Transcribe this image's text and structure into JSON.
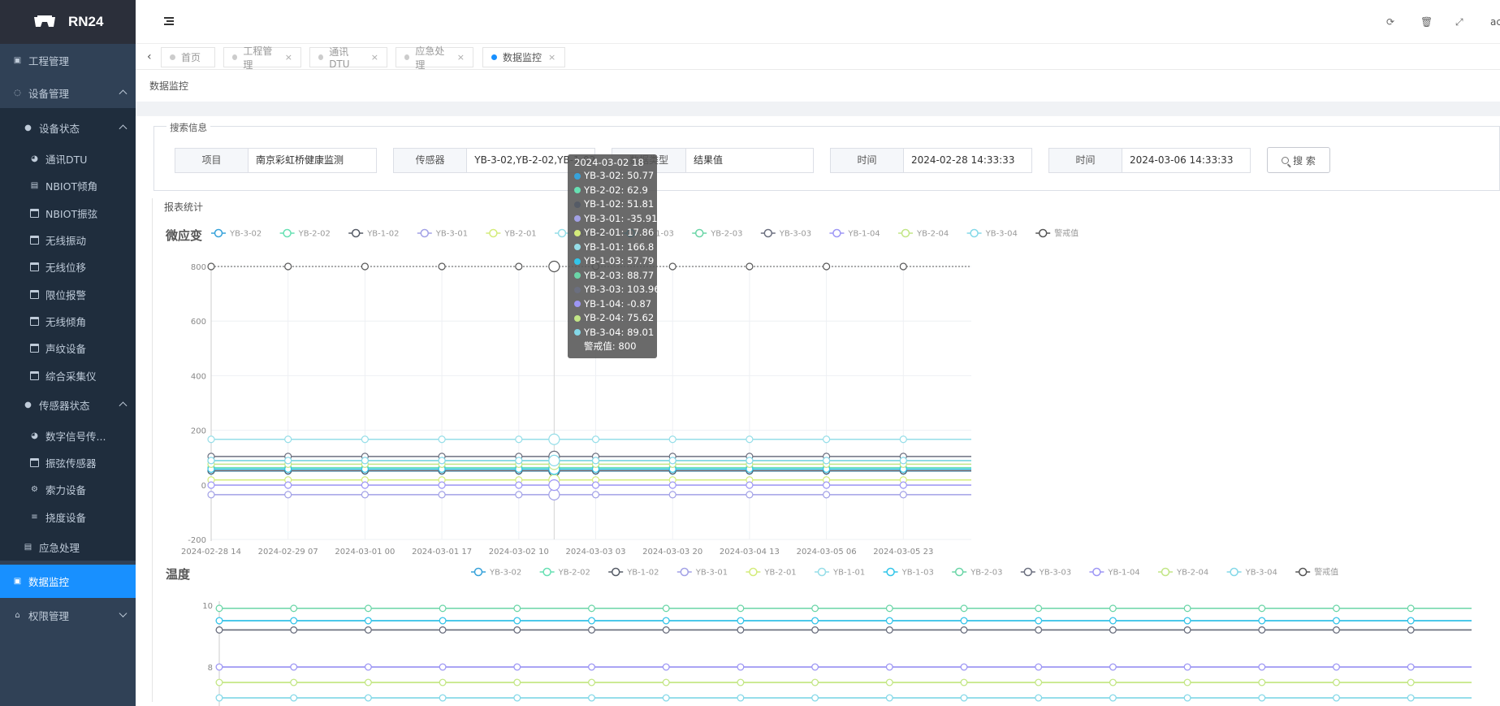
{
  "brand": {
    "name": "RN24"
  },
  "sidebar": {
    "items": [
      {
        "label": "工程管理",
        "icon": "file-icon"
      },
      {
        "label": "设备管理",
        "icon": "chat-icon"
      },
      {
        "label": "设备状态",
        "icon": "status-icon"
      },
      {
        "label": "通讯DTU",
        "icon": "dashboard-icon"
      },
      {
        "label": "NBIOT倾角",
        "icon": "document-icon"
      },
      {
        "label": "NBIOT振弦",
        "icon": "window-icon"
      },
      {
        "label": "无线振动",
        "icon": "window-icon"
      },
      {
        "label": "无线位移",
        "icon": "window-icon"
      },
      {
        "label": "限位报警",
        "icon": "window-icon"
      },
      {
        "label": "无线倾角",
        "icon": "window-icon"
      },
      {
        "label": "声纹设备",
        "icon": "window-icon"
      },
      {
        "label": "综合采集仪",
        "icon": "window-icon"
      },
      {
        "label": "传感器状态",
        "icon": "status-icon"
      },
      {
        "label": "数字信号传...",
        "icon": "dashboard-icon"
      },
      {
        "label": "振弦传感器",
        "icon": "window-icon"
      },
      {
        "label": "索力设备",
        "icon": "gears-icon"
      },
      {
        "label": "挠度设备",
        "icon": "list-icon"
      },
      {
        "label": "应急处理",
        "icon": "document-icon"
      },
      {
        "label": "数据监控",
        "icon": "monitor-icon"
      },
      {
        "label": "权限管理",
        "icon": "home-icon"
      }
    ]
  },
  "topbar": {
    "user_initial": "ac"
  },
  "tabs": [
    {
      "label": "首页"
    },
    {
      "label": "工程管理"
    },
    {
      "label": "通讯DTU"
    },
    {
      "label": "应急处理"
    },
    {
      "label": "数据监控"
    }
  ],
  "breadcrumb": "数据监控",
  "search": {
    "legend": "搜索信息",
    "project_label": "项目",
    "project_value": "南京彩虹桥健康监测",
    "sensor_label": "传感器",
    "sensor_value": "YB-3-02,YB-2-02,YB-1-02",
    "type_label": "数据类型",
    "type_value": "结果值",
    "start_label": "时间",
    "start_value": "2024-02-28 14:33:33",
    "end_label": "时间",
    "end_value": "2024-03-06 14:33:33",
    "button_label": "搜 索"
  },
  "report_title": "报表统计",
  "colors": {
    "YB-3-02": "#37a2da",
    "YB-2-02": "#67e0b3",
    "YB-1-02": "#555b66",
    "YB-3-01": "#a2a1e6",
    "YB-2-01": "#d4ec7b",
    "YB-1-01": "#96dee8",
    "YB-1-03": "#32c5e9",
    "YB-2-03": "#6bd5a7",
    "YB-3-03": "#6b6f7f",
    "YB-1-04": "#9d96f5",
    "YB-2-04": "#c2e686",
    "YB-3-04": "#84d8e8",
    "警戒值": "#555555"
  },
  "chart_data": [
    {
      "type": "line",
      "title": "微应变",
      "categories": [
        "2024-02-28 14",
        "2024-02-29 07",
        "2024-03-01 00",
        "2024-03-01 17",
        "2024-03-02 10",
        "2024-03-02 18",
        "2024-03-03 03",
        "2024-03-03 20",
        "2024-03-04 13",
        "2024-03-05 06",
        "2024-03-05 23"
      ],
      "x_tick_labels": [
        "2024-02-28 14",
        "2024-02-29 07",
        "2024-03-01 00",
        "2024-03-01 17",
        "2024-03-02 10",
        "2024-03-03 03",
        "2024-03-03 20",
        "2024-03-04 13",
        "2024-03-05 06",
        "2024-03-05 23"
      ],
      "ylim": [
        -200,
        800
      ],
      "y_ticks": [
        -200,
        0,
        200,
        400,
        600,
        800
      ],
      "legend": "top",
      "grid": true,
      "series": [
        {
          "name": "YB-3-02",
          "value": 50.77
        },
        {
          "name": "YB-2-02",
          "value": 62.9
        },
        {
          "name": "YB-1-02",
          "value": 51.81
        },
        {
          "name": "YB-3-01",
          "value": -35.91
        },
        {
          "name": "YB-2-01",
          "value": 17.86
        },
        {
          "name": "YB-1-01",
          "value": 166.8
        },
        {
          "name": "YB-1-03",
          "value": 57.79
        },
        {
          "name": "YB-2-03",
          "value": 88.77
        },
        {
          "name": "YB-3-03",
          "value": 103.96
        },
        {
          "name": "YB-1-04",
          "value": -0.87
        },
        {
          "name": "YB-2-04",
          "value": 75.62
        },
        {
          "name": "YB-3-04",
          "value": 89.01
        },
        {
          "name": "警戒值",
          "value": 800
        }
      ],
      "tooltip": {
        "title": "2024-03-02 18"
      }
    },
    {
      "type": "line",
      "title": "温度",
      "categories": 17,
      "y_ticks": [
        8,
        10
      ],
      "legend": "top",
      "grid": false,
      "series": [
        {
          "name": "YB-3-02",
          "value": 9.5
        },
        {
          "name": "YB-2-02",
          "value": 9.9
        },
        {
          "name": "YB-1-02",
          "value": 9.2
        },
        {
          "name": "YB-3-01",
          "value": 8
        },
        {
          "name": "YB-2-01",
          "value": 7.5
        },
        {
          "name": "YB-1-01",
          "value": 7
        },
        {
          "name": "YB-1-03",
          "value": 9.5
        },
        {
          "name": "YB-2-03",
          "value": 9.9
        },
        {
          "name": "YB-3-03",
          "value": 9.2
        },
        {
          "name": "YB-1-04",
          "value": 8
        },
        {
          "name": "YB-2-04",
          "value": 7.5
        },
        {
          "name": "YB-3-04",
          "value": 7
        },
        {
          "name": "警戒值",
          "value": null
        }
      ]
    }
  ]
}
